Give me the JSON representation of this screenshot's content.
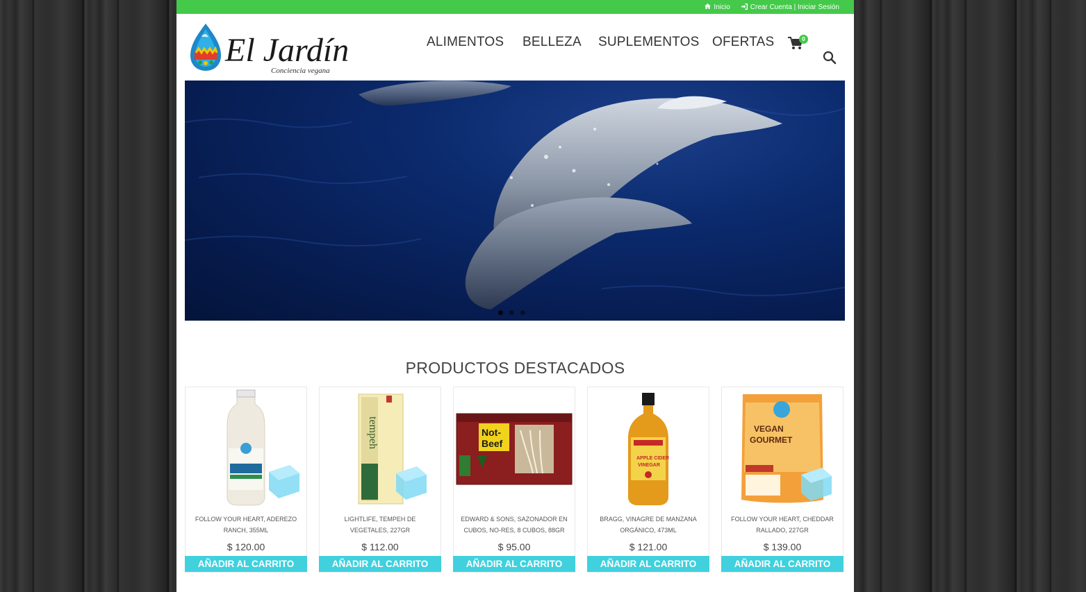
{
  "topbar": {
    "home_label": "Inicio",
    "account_label": "Crear Cuenta | Iniciar Sesión"
  },
  "brand": {
    "name": "El Jardín",
    "tagline": "Conciencia vegana"
  },
  "nav": {
    "items": [
      {
        "label": "ALIMENTOS"
      },
      {
        "label": "BELLEZA"
      },
      {
        "label": "SUPLEMENTOS"
      },
      {
        "label": "OFERTAS"
      }
    ],
    "cart_count": "0"
  },
  "slider": {
    "dot_count": 3,
    "active_index": 0
  },
  "featured": {
    "title": "PRODUCTOS DESTACADOS",
    "add_label": "AÑADIR AL CARRITO",
    "products": [
      {
        "name": "FOLLOW YOUR HEART, ADEREZO RANCH, 355ML",
        "price": "$ 120.00"
      },
      {
        "name": "LIGHTLIFE, TEMPEH DE VEGETALES, 227GR",
        "price": "$ 112.00"
      },
      {
        "name": "EDWARD & SONS, SAZONADOR EN CUBOS, NO-RES, 8 CUBOS, 88GR",
        "price": "$ 95.00"
      },
      {
        "name": "BRAGG, VINAGRE DE MANZANA ORGÁNICO, 473ML",
        "price": "$ 121.00"
      },
      {
        "name": "FOLLOW YOUR HEART, CHEDDAR RALLADO, 227GR",
        "price": "$ 139.00"
      }
    ]
  },
  "colors": {
    "topbar": "#44c94a",
    "button": "#40d0de"
  }
}
